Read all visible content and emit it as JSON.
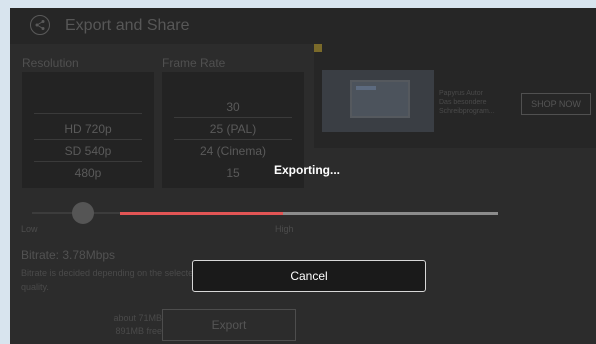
{
  "header": {
    "title": "Export and Share"
  },
  "resolution": {
    "label": "Resolution",
    "options": [
      "HD 720p",
      "SD 540p",
      "480p"
    ]
  },
  "frame_rate": {
    "label": "Frame Rate",
    "options": [
      "30",
      "25 (PAL)",
      "24 (Cinema)",
      "15"
    ]
  },
  "ad": {
    "line1": "Papyrus Autor",
    "line2": "Das besondere",
    "line3": "Schreibprogram...",
    "cta": "SHOP NOW"
  },
  "quality": {
    "low": "Low",
    "high": "High"
  },
  "bitrate": {
    "text": "Bitrate: 3.78Mbps",
    "note": "Bitrate is decided depending on the selected video resolution and quality."
  },
  "export": {
    "size_about": "about 71MB",
    "free": "891MB free",
    "button": "Export"
  },
  "dialog": {
    "title": "Exporting...",
    "progress": 0.43,
    "cancel": "Cancel",
    "progress_color": "#e25555"
  },
  "colors": {
    "background": "#2c2c2c",
    "accent": "#e25555"
  }
}
